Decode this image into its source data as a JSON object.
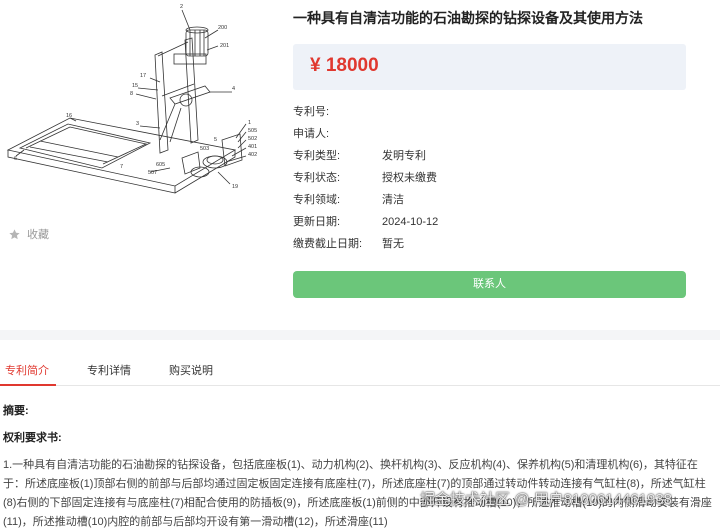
{
  "product": {
    "title": "一种具有自清洁功能的石油勘探的钻探设备及其使用方法",
    "price": "¥ 18000",
    "favorite_label": "收藏"
  },
  "figure_labels": [
    "2",
    "200",
    "201",
    "17",
    "15",
    "8",
    "4",
    "3",
    "16",
    "1",
    "505",
    "502",
    "401",
    "402",
    "5",
    "503",
    "507",
    "605",
    "19",
    "6",
    "7"
  ],
  "info": [
    {
      "label": "专利号:",
      "value": ""
    },
    {
      "label": "申请人:",
      "value": ""
    },
    {
      "label": "专利类型:",
      "value": "发明专利"
    },
    {
      "label": "专利状态:",
      "value": "授权未缴费"
    },
    {
      "label": "专利领域:",
      "value": "清洁"
    },
    {
      "label": "更新日期:",
      "value": "2024-10-12"
    },
    {
      "label": "缴费截止日期:",
      "value": "暂无"
    }
  ],
  "contact_button": "联系人",
  "tabs": [
    {
      "label": "专利简介",
      "active": true
    },
    {
      "label": "专利详情",
      "active": false
    },
    {
      "label": "购买说明",
      "active": false
    }
  ],
  "content": {
    "abstract_heading": "摘要:",
    "claims_heading": "权利要求书:",
    "claims_text": "1.一种具有自清洁功能的石油勘探的钻探设备，包括底座板(1)、动力机构(2)、换杆机构(3)、反应机构(4)、保养机构(5)和清理机构(6)，其特征在于：所述底座板(1)顶部右侧的前部与后部均通过固定板固定连接有底座柱(7)，所述底座柱(7)的顶部通过转动件转动连接有气缸柱(8)，所述气缸柱(8)右侧的下部固定连接有与底座柱(7)相配合使用的防插板(9)，所述底座板(1)前侧的中部开设有推动槽(10)，所述推动槽(10)的内侧滑动安装有滑座(11)，所述推动槽(10)内腔的前部与后部均开设有第一滑动槽(12)，所述滑座(11)"
  },
  "watermark": "掘金技术社区 @ 用户8100614461938",
  "colors": {
    "accent_red": "#e0382f",
    "button_green": "#6bc67a",
    "price_bg": "#eef2f8"
  }
}
